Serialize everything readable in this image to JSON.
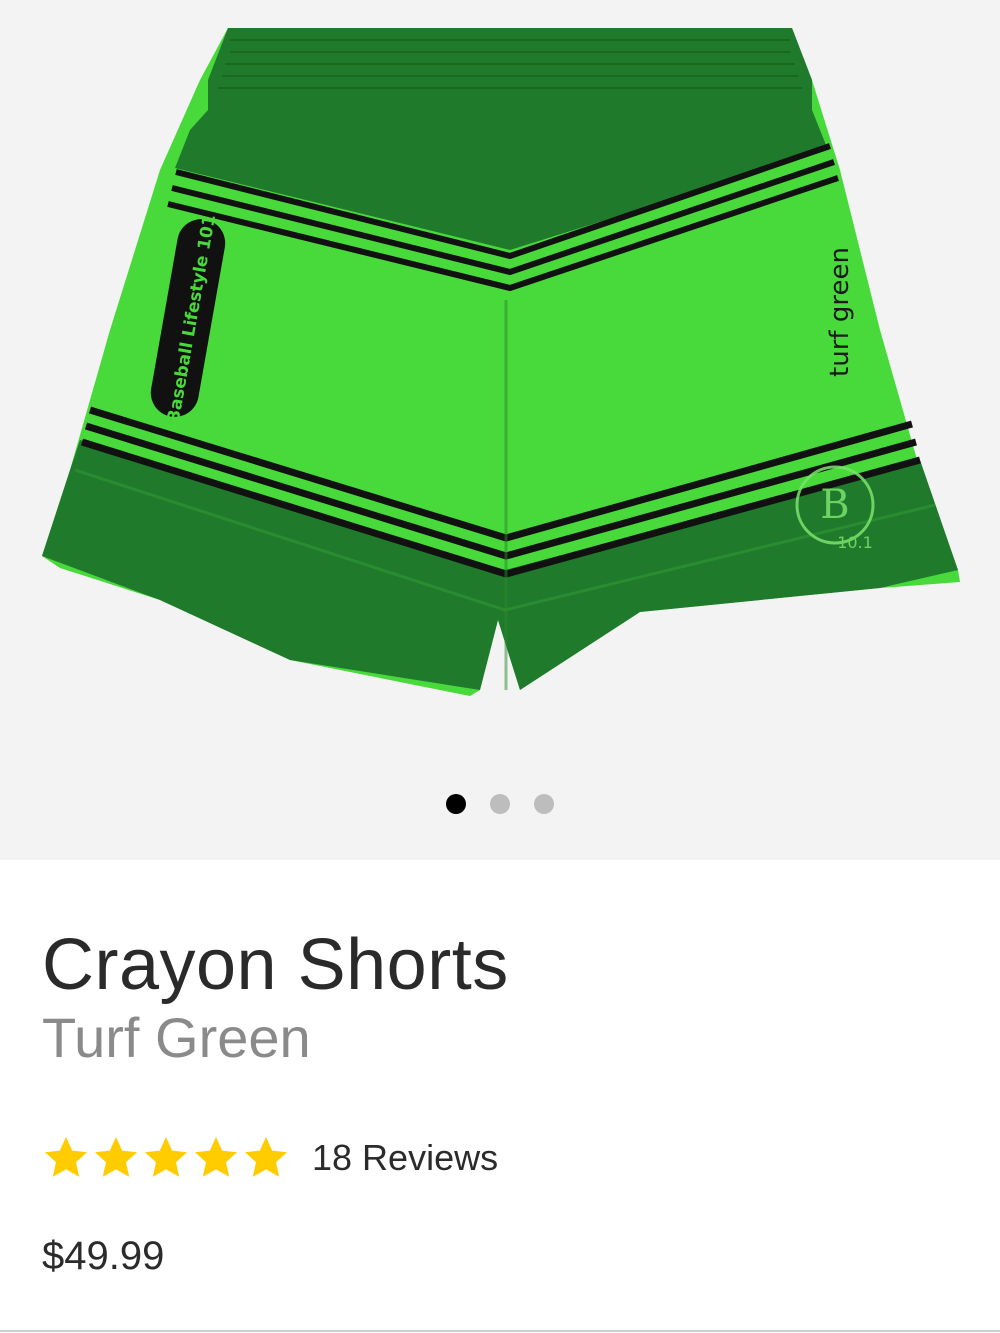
{
  "product": {
    "image": {
      "body_color": "#48d93a",
      "band_color": "#1f7a2c",
      "stripe_color": "#111111",
      "pocket_label": "Baseball Lifestyle 101",
      "leg_label": "turf green",
      "logo_text": "10.1"
    },
    "gallery": {
      "slide_count": 3,
      "active_slide": 1
    },
    "name": "Crayon Shorts",
    "color_name": "Turf Green",
    "rating": {
      "stars": 5,
      "max_stars": 5,
      "star_color": "#ffcc00",
      "reviews_text": "18 Reviews"
    },
    "price": "$49.99"
  }
}
